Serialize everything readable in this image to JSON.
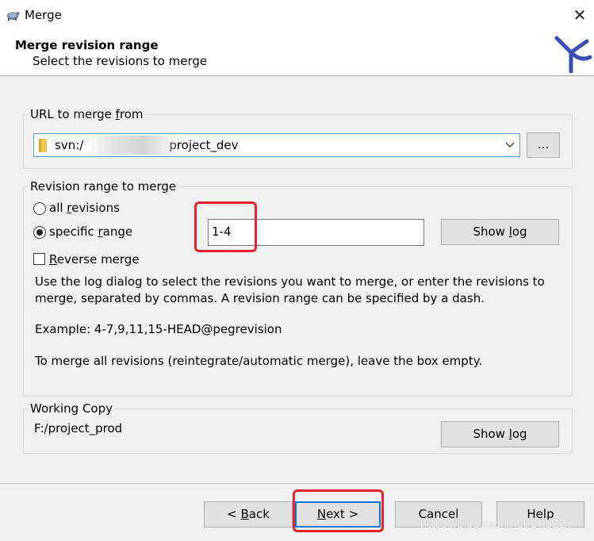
{
  "window": {
    "title": "Merge",
    "close_glyph": "✕",
    "app_icon": "tortoise-icon"
  },
  "header": {
    "title": "Merge revision range",
    "subtitle": "Select the revisions to merge",
    "logo": "tortoisesvn-logo"
  },
  "url_group": {
    "label_pre": "URL to merge ",
    "label_key": "f",
    "label_post": "rom",
    "url_prefix": "svn:/",
    "url_suffix": "project_dev",
    "browse_label": "..."
  },
  "range_group": {
    "label": "Revision range to merge",
    "all_revisions": {
      "pre": "all ",
      "key": "r",
      "post": "evisions",
      "checked": false
    },
    "specific_range": {
      "pre": "specific ",
      "key": "r",
      "post": "ange",
      "checked": true
    },
    "range_value": "1-4",
    "show_log": {
      "pre": "Show ",
      "key": "l",
      "post": "og"
    },
    "reverse_merge": {
      "pre": "",
      "key": "R",
      "post": "everse merge",
      "checked": false
    },
    "description_1": "Use the log dialog to select the revisions you want to merge, or enter the revisions to merge, separated by commas. A revision range can be specified by a dash.",
    "example": "Example: 4-7,9,11,15-HEAD@pegrevision",
    "description_2": "To merge all revisions (reintegrate/automatic merge), leave the box empty."
  },
  "working_copy": {
    "label": "Working Copy",
    "path": "F:/project_prod",
    "show_log": {
      "pre": "Show ",
      "key": "l",
      "post": "og"
    }
  },
  "footer": {
    "back": {
      "pre": "< ",
      "key": "B",
      "post": "ack"
    },
    "next": {
      "pre": "",
      "key": "N",
      "post": "ext >"
    },
    "cancel": "Cancel",
    "help": "Help"
  },
  "watermark": "https://blog.csdn.net/BHSZZY",
  "colors": {
    "annotation": "#e8232a",
    "focus": "#0078d7"
  }
}
